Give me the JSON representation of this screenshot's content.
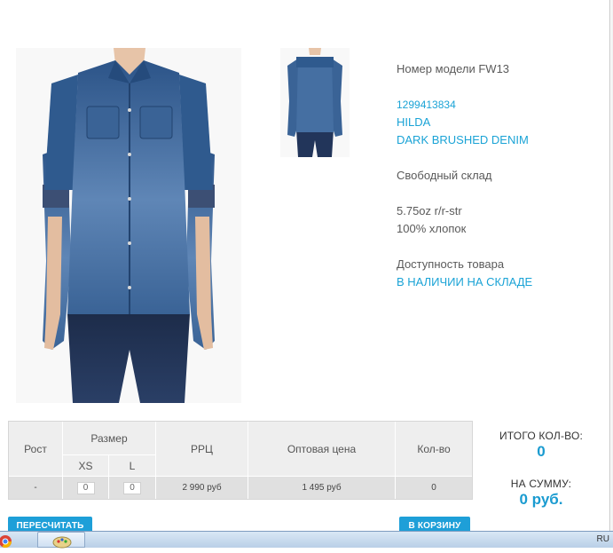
{
  "product": {
    "model_line": "Номер модели FW13",
    "sku": "1299413834",
    "name": "HILDA",
    "variant": "DARK BRUSHED DENIM",
    "stock_type": "Свободный склад",
    "fabric": "5.75oz r/r-str",
    "composition": "100% хлопок",
    "availability_label": "Доступность товара",
    "availability_value": "В НАЛИЧИИ НА СКЛАДЕ"
  },
  "table": {
    "headers": {
      "height": "Рост",
      "size": "Размер",
      "rrp": "РРЦ",
      "wholesale": "Оптовая цена",
      "qty": "Кол-во"
    },
    "sizes": [
      "XS",
      "L"
    ],
    "row": {
      "height": "-",
      "qty_inputs": [
        "0",
        "0"
      ],
      "rrp": "2 990 руб",
      "wholesale": "1 495 руб",
      "qty": "0"
    }
  },
  "totals": {
    "count_label": "ИТОГО КОЛ-ВО:",
    "count_value": "0",
    "sum_label": "НА СУММУ:",
    "sum_value": "0 руб."
  },
  "buttons": {
    "recalc": "ПЕРЕСЧИТАТЬ",
    "cart": "В КОРЗИНУ"
  },
  "taskbar": {
    "lang": "RU"
  },
  "colors": {
    "accent": "#1aa3d6",
    "button": "#1e9fd8",
    "denim": "#2f5a8e"
  }
}
